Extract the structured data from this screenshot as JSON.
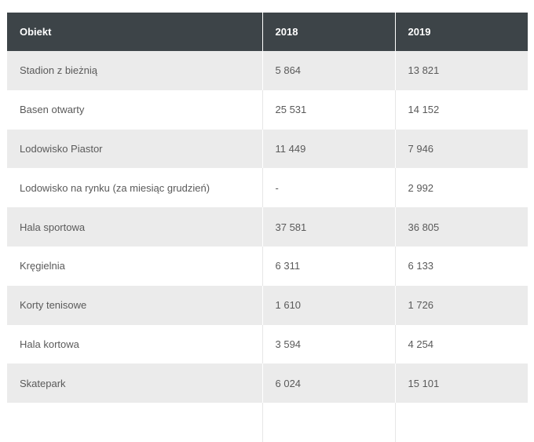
{
  "table": {
    "headers": [
      "Obiekt",
      "2018",
      "2019"
    ],
    "rows": [
      [
        "Stadion z bieżnią",
        "5 864",
        "13 821"
      ],
      [
        "Basen otwarty",
        "25 531",
        "14 152"
      ],
      [
        "Lodowisko Piastor",
        "11 449",
        "7 946"
      ],
      [
        "Lodowisko na rynku (za miesiąc grudzień)",
        "-",
        "2 992"
      ],
      [
        "Hala sportowa",
        "37 581",
        "36 805"
      ],
      [
        "Kręgielnia",
        "6 311",
        "6 133"
      ],
      [
        "Korty tenisowe",
        "1 610",
        "1 726"
      ],
      [
        "Hala kortowa",
        "3 594",
        "4 254"
      ],
      [
        "Skatepark",
        "6 024",
        "15 101"
      ],
      [
        "",
        "",
        ""
      ]
    ]
  },
  "colors": {
    "header_bg": "#3d4448",
    "header_text": "#ffffff",
    "stripe_bg": "#ebebeb",
    "cell_text": "#5a5a5a"
  }
}
